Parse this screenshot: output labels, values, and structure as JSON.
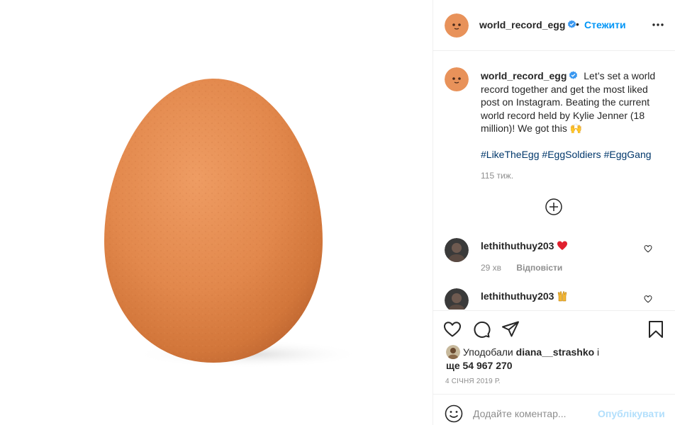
{
  "post": {
    "image_alt": "egg",
    "author": {
      "username": "world_record_egg",
      "verified": true,
      "follow_label": "Стежити",
      "separator": "•"
    },
    "caption": {
      "username": "world_record_egg",
      "text": "Let’s set a world record together and get the most liked post on Instagram. Beating the current world record held by Kylie Jenner (18 million)! We got this",
      "emoji": "🙌",
      "hashtags": [
        "#LikeTheEgg",
        "#EggSoldiers",
        "#EggGang"
      ],
      "time": "115 тиж."
    },
    "comments": [
      {
        "username": "lethithuthuy203",
        "emoji": "❤️",
        "time": "29 хв",
        "reply_label": "Відповісти"
      },
      {
        "username": "lethithuthuy203",
        "emoji": "🙌"
      }
    ],
    "likes": {
      "prefix": "Уподобали",
      "liker": "diana__strashko",
      "connector": "і",
      "others_prefix": "ще",
      "count": "54 967 270"
    },
    "date": "4 СІЧНЯ 2019 Р.",
    "add_comment": {
      "placeholder": "Додайте коментар...",
      "publish_label": "Опублікувати"
    }
  },
  "colors": {
    "link": "#0095f6",
    "hashtag": "#00376b",
    "muted": "#8e8e8e",
    "publish_disabled": "#b2dffc",
    "heart": "#ed4956"
  },
  "icons": {
    "header_more": "more-dots-icon",
    "load_more": "plus-circle-icon",
    "like": "heart-outline-icon",
    "comment": "comment-bubble-icon",
    "share": "paper-plane-icon",
    "save": "bookmark-icon",
    "emoji": "smiley-icon"
  }
}
